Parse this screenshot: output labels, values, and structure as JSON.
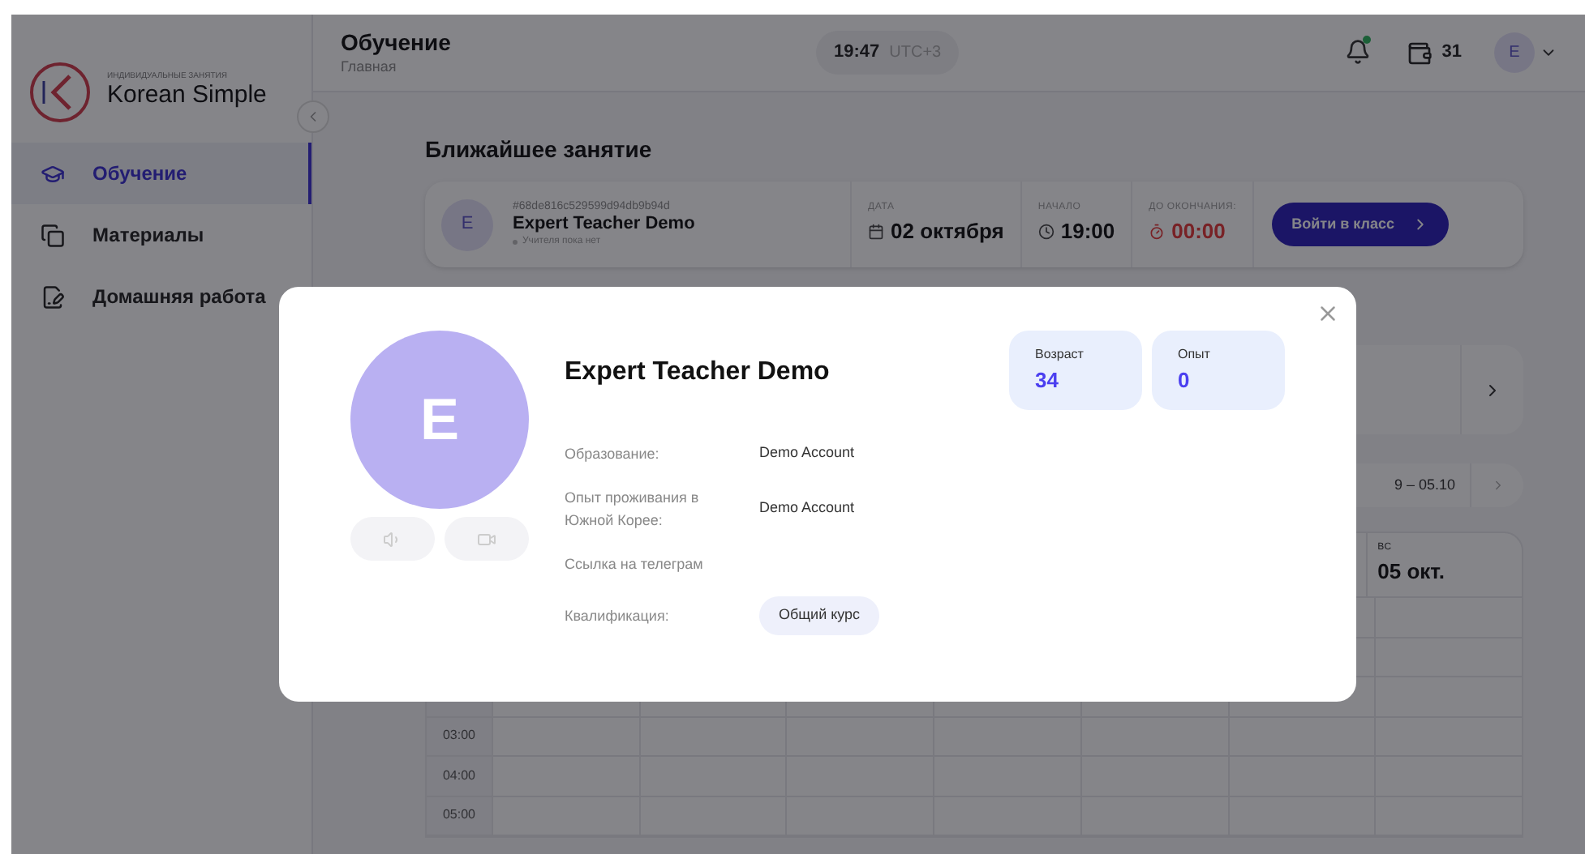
{
  "sidebar": {
    "logo": {
      "tagline": "ИНДИВИДУАЛЬНЫЕ ЗАНЯТИЯ",
      "name": "Korean Simple"
    },
    "items": [
      {
        "label": "Обучение",
        "kind": "study",
        "selected": true
      },
      {
        "label": "Материалы",
        "kind": "materials",
        "selected": false
      },
      {
        "label": "Домашняя работа",
        "kind": "homework",
        "selected": false
      }
    ]
  },
  "header": {
    "title": "Обучение",
    "subtitle": "Главная",
    "time": "19:47",
    "timezone": "UTC+3",
    "notifications_unread": true,
    "wallet_count": "31",
    "avatar_letter": "E"
  },
  "nearest": {
    "heading": "Ближайшее занятие",
    "teacher": {
      "avatar_letter": "E",
      "id": "#68de816c529599d94db9b94d",
      "name": "Expert Teacher Demo",
      "status": "Учителя пока нет"
    },
    "fields": [
      {
        "label": "ДАТА",
        "value": "02 октября",
        "kind": "date"
      },
      {
        "label": "НАЧАЛО",
        "value": "19:00",
        "kind": "time"
      },
      {
        "label": "ДО ОКОНЧАНИЯ:",
        "value": "00:00",
        "kind": "countdown"
      }
    ],
    "join_button": "Войти в класс"
  },
  "week": {
    "range": "9 – 05.10"
  },
  "calendar": {
    "days": [
      {
        "weekday": "ВС",
        "date": "05 окт."
      }
    ],
    "hours": [
      "03:00",
      "04:00",
      "05:00"
    ]
  },
  "modal": {
    "avatar_letter": "E",
    "name": "Expert Teacher Demo",
    "stats": [
      {
        "label": "Возраст",
        "value": "34"
      },
      {
        "label": "Опыт",
        "value": "0"
      }
    ],
    "info": [
      {
        "label": "Образование:",
        "value": "Demo Account",
        "kind": "text"
      },
      {
        "label": "Опыт проживания в Южной Корее:",
        "value": "Demo Account",
        "kind": "text"
      },
      {
        "label": "Ссылка на телеграм",
        "kind": "text"
      },
      {
        "label": "Квалификация:",
        "value": "Общий курс",
        "kind": "chip"
      }
    ]
  }
}
